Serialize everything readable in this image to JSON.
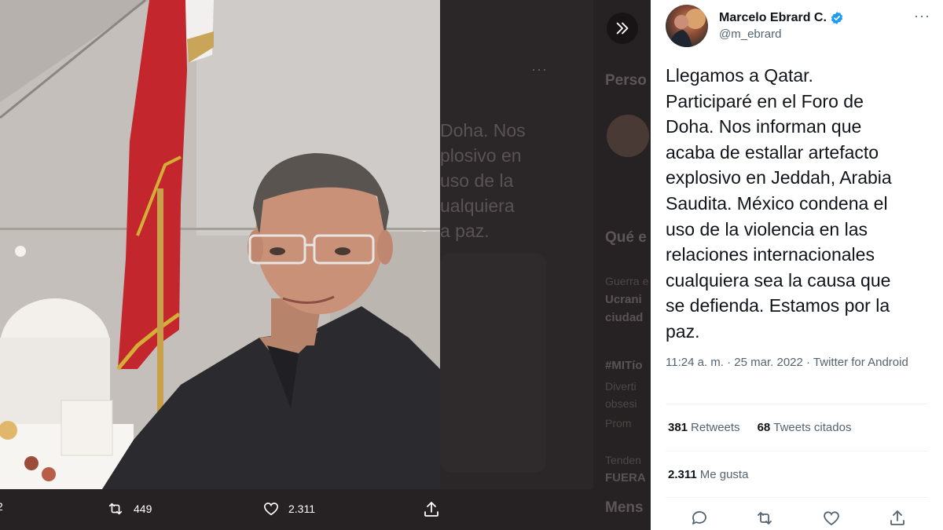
{
  "author": {
    "name": "Marcelo Ebrard C.",
    "handle": "@m_ebrard"
  },
  "tweet": {
    "text_lines": [
      "Llegamos a Qatar.",
      "Participaré en el Foro de",
      "Doha. Nos informan que",
      "acaba de estallar artefacto",
      "explosivo en Jeddah, Arabia",
      "Saudita. México condena el",
      "uso de la violencia en las",
      "relaciones internacionales",
      "cualquiera sea la causa que",
      "se defienda. Estamos por la",
      "paz."
    ],
    "time": "11:24 a. m.",
    "separator": "·",
    "date": "25 mar. 2022",
    "source": "Twitter for Android"
  },
  "stats": {
    "retweets_count": "381",
    "retweets_label": "Retweets",
    "quotes_count": "68",
    "quotes_label": "Tweets citados",
    "likes_count": "2.311",
    "likes_label": "Me gusta"
  },
  "photo_bar": {
    "replies_partial": "2",
    "retweets": "449",
    "likes": "2.311"
  },
  "background": {
    "tweet_fragment_lines": [
      "Doha. Nos",
      "plosivo en",
      "uso de la",
      "ualquiera",
      "a paz."
    ],
    "right_col": {
      "heading1": "Perso",
      "heading2": "Qué e",
      "trend1_context": "Guerra e",
      "trend1_title_a": "Ucrani",
      "trend1_title_b": "ciudad",
      "trend2_title": "#MITío",
      "trend2_desc_a": "Diverti",
      "trend2_desc_b": "obsesi",
      "trend2_promo": "Prom",
      "trend3_context": "Tenden",
      "trend3_title": "FUERA",
      "heading3": "Mens"
    }
  },
  "colors": {
    "verified": "#1d9bf0",
    "text_primary": "#0f1419",
    "text_secondary": "#536471",
    "panel_bg": "#ffffff",
    "overlay_bg": "#2b2627"
  }
}
